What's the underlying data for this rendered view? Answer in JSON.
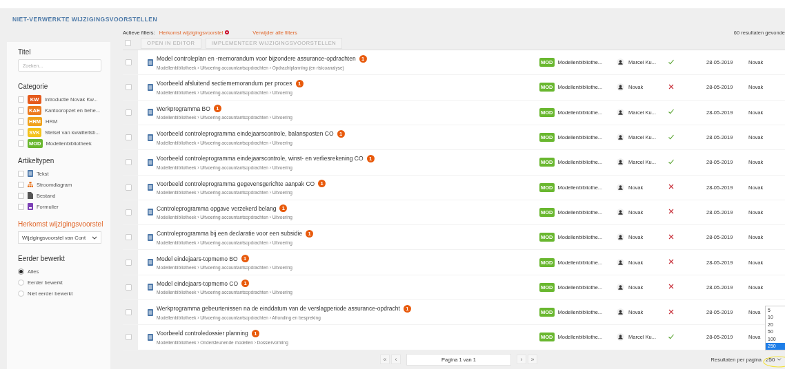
{
  "page_title": "NIET-VERWERKTE WIJZIGINGSVOORSTELLEN",
  "active_filters": {
    "label": "Actieve filters:",
    "filters": [
      "Herkomst wijzigingsvoorstel"
    ],
    "clear_all": "Verwijder alle filters"
  },
  "result_count": "60 resultaten gevonde",
  "toolbar": {
    "select_all_checked": false,
    "buttons": [
      "OPEN IN EDITOR",
      "IMPLEMENTEER WIJZIGINGSVOORSTELLEN"
    ]
  },
  "sidebar": {
    "title_filter": {
      "label": "Titel",
      "placeholder": "Zoeken..."
    },
    "category": {
      "label": "Categorie",
      "items": [
        {
          "code": "KW",
          "label": "Introductie Novak Kw...",
          "color": "#e55a1c",
          "checked": false
        },
        {
          "code": "KAE",
          "label": "Kantooropzet en behe...",
          "color": "#ec7a1e",
          "checked": false
        },
        {
          "code": "HRM",
          "label": "HRM",
          "color": "#f0a21c",
          "checked": false
        },
        {
          "code": "SVK",
          "label": "Stelsel van kwaliteitsb...",
          "color": "#f4c21a",
          "checked": false
        },
        {
          "code": "MOD",
          "label": "Modellenbibliotheek",
          "color": "#69b72f",
          "checked": false
        }
      ]
    },
    "article_types": {
      "label": "Artikeltypen",
      "items": [
        {
          "kind": "text",
          "label": "Tekst",
          "checked": false
        },
        {
          "kind": "flowchart",
          "label": "Stroomdiagram",
          "checked": false
        },
        {
          "kind": "file",
          "label": "Bestand",
          "checked": false
        },
        {
          "kind": "form",
          "label": "Formulier",
          "checked": false
        }
      ]
    },
    "origin": {
      "label": "Herkomst wijzigingsvoorstel",
      "active": true,
      "value": "Wijzigingsvoorstel van Cont"
    },
    "edited": {
      "label": "Eerder bewerkt",
      "options": [
        {
          "label": "Alles",
          "selected": true
        },
        {
          "label": "Eerder bewerkt",
          "selected": false
        },
        {
          "label": "Niet eerder bewerkt",
          "selected": false
        }
      ]
    }
  },
  "rows": [
    {
      "title": "Model controleplan en -memorandum voor bijzondere assurance-opdrachten",
      "badge": "1",
      "path": "Modellenbibliotheek › Uitvoering accountantsopdrachten › Opdrachtplanning (en risicoanalyse)",
      "source_code": "MOD",
      "source": "Modellenbibliothe...",
      "user": "Marcel Ku...",
      "approved": true,
      "date": "28-05-2019",
      "editor": "Novak",
      "checked": false
    },
    {
      "title": "Voorbeeld afsluitend sectiememorandum per proces",
      "badge": "1",
      "path": "Modellenbibliotheek › Uitvoering accountantsopdrachten › Uitvoering",
      "source_code": "MOD",
      "source": "Modellenbibliothe...",
      "user": "Novak",
      "approved": false,
      "date": "28-05-2019",
      "editor": "Novak",
      "checked": false
    },
    {
      "title": "Werkprogramma BO",
      "badge": "1",
      "path": "Modellenbibliotheek › Uitvoering accountantsopdrachten › Uitvoering",
      "source_code": "MOD",
      "source": "Modellenbibliothe...",
      "user": "Marcel Ku...",
      "approved": true,
      "date": "28-05-2019",
      "editor": "Novak",
      "checked": false
    },
    {
      "title": "Voorbeeld controleprogramma eindejaarscontrole, balansposten CO",
      "badge": "1",
      "path": "Modellenbibliotheek › Uitvoering accountantsopdrachten › Uitvoering",
      "source_code": "MOD",
      "source": "Modellenbibliothe...",
      "user": "Marcel Ku...",
      "approved": true,
      "date": "28-05-2019",
      "editor": "Novak",
      "checked": false
    },
    {
      "title": "Voorbeeld controleprogramma eindejaarscontrole, winst- en verliesrekening CO",
      "badge": "1",
      "path": "Modellenbibliotheek › Uitvoering accountantsopdrachten › Uitvoering",
      "source_code": "MOD",
      "source": "Modellenbibliothe...",
      "user": "Marcel Ku...",
      "approved": true,
      "date": "28-05-2019",
      "editor": "Novak",
      "checked": false
    },
    {
      "title": "Voorbeeld controleprogramma gegevensgerichte aanpak CO",
      "badge": "1",
      "path": "Modellenbibliotheek › Uitvoering accountantsopdrachten › Uitvoering",
      "source_code": "MOD",
      "source": "Modellenbibliothe...",
      "user": "Novak",
      "approved": false,
      "date": "28-05-2019",
      "editor": "Novak",
      "checked": false
    },
    {
      "title": "Controleprogramma opgave verzekerd belang",
      "badge": "1",
      "path": "Modellenbibliotheek › Uitvoering accountantsopdrachten › Uitvoering",
      "source_code": "MOD",
      "source": "Modellenbibliothe...",
      "user": "Novak",
      "approved": false,
      "date": "28-05-2019",
      "editor": "Novak",
      "checked": false
    },
    {
      "title": "Controleprogramma bij een declaratie voor een subsidie",
      "badge": "1",
      "path": "Modellenbibliotheek › Uitvoering accountantsopdrachten › Uitvoering",
      "source_code": "MOD",
      "source": "Modellenbibliothe...",
      "user": "Novak",
      "approved": false,
      "date": "28-05-2019",
      "editor": "Novak",
      "checked": false
    },
    {
      "title": "Model eindejaars-topmemo BO",
      "badge": "1",
      "path": "Modellenbibliotheek › Uitvoering accountantsopdrachten › Uitvoering",
      "source_code": "MOD",
      "source": "Modellenbibliothe...",
      "user": "Novak",
      "approved": false,
      "date": "28-05-2019",
      "editor": "Novak",
      "checked": false
    },
    {
      "title": "Model eindejaars-topmemo CO",
      "badge": "1",
      "path": "Modellenbibliotheek › Uitvoering accountantsopdrachten › Uitvoering",
      "source_code": "MOD",
      "source": "Modellenbibliothe...",
      "user": "Novak",
      "approved": false,
      "date": "28-05-2019",
      "editor": "Novak",
      "checked": false
    },
    {
      "title": "Werkprogramma gebeurtenissen na de einddatum van de verslagperiode assurance-opdracht",
      "badge": "1",
      "path": "Modellenbibliotheek › Uitvoering accountantsopdrachten › Afronding en bespreking",
      "source_code": "MOD",
      "source": "Modellenbibliothe...",
      "user": "Novak",
      "approved": false,
      "date": "28-05-2019",
      "editor": "Nova",
      "checked": false
    },
    {
      "title": "Voorbeeld controledossier planning",
      "badge": "1",
      "path": "Modellenbibliotheek › Ondersteunende modellen › Dossiervorming",
      "source_code": "MOD",
      "source": "Modellenbibliothe...",
      "user": "Marcel Ku...",
      "approved": true,
      "date": "28-05-2019",
      "editor": "Nova",
      "checked": false
    }
  ],
  "pagination": {
    "first": "«",
    "prev": "‹",
    "page": "Pagina 1 van 1",
    "next": "›",
    "last": "»",
    "per_page_label": "Resultaten per pagina",
    "per_page": "250",
    "per_page_options": [
      {
        "label": "5",
        "selected": false
      },
      {
        "label": "10",
        "selected": false
      },
      {
        "label": "20",
        "selected": false
      },
      {
        "label": "50",
        "selected": false
      },
      {
        "label": "100",
        "selected": false
      },
      {
        "label": "250",
        "selected": true
      }
    ]
  }
}
